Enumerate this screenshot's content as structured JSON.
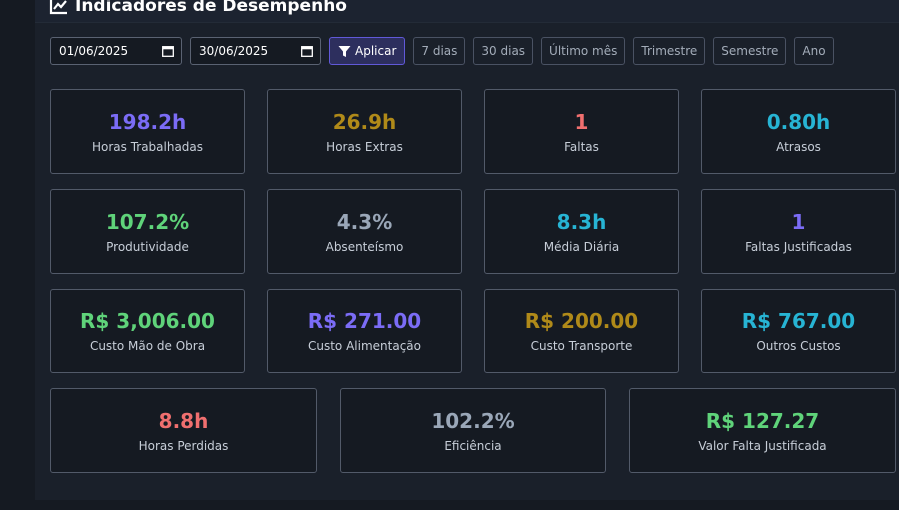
{
  "header": {
    "title": "Indicadores de Desempenho",
    "icon": "chart-line-icon"
  },
  "filters": {
    "start_date": "01/06/2025",
    "end_date": "30/06/2025",
    "apply_label": "Aplicar",
    "presets": [
      "7 dias",
      "30 dias",
      "Último mês",
      "Trimestre",
      "Semestre",
      "Ano"
    ]
  },
  "colors": {
    "purple": "#7b6cf6",
    "gold": "#b08a19",
    "red": "#f06f6f",
    "cyan": "#27b4d4",
    "green": "#5fd37a",
    "slate": "#9aa7b8"
  },
  "metrics": [
    {
      "value": "198.2h",
      "label": "Horas Trabalhadas",
      "color": "#7b6cf6"
    },
    {
      "value": "26.9h",
      "label": "Horas Extras",
      "color": "#b08a19"
    },
    {
      "value": "1",
      "label": "Faltas",
      "color": "#f06f6f"
    },
    {
      "value": "0.80h",
      "label": "Atrasos",
      "color": "#27b4d4"
    },
    {
      "value": "107.2%",
      "label": "Produtividade",
      "color": "#5fd37a"
    },
    {
      "value": "4.3%",
      "label": "Absenteísmo",
      "color": "#9aa7b8"
    },
    {
      "value": "8.3h",
      "label": "Média Diária",
      "color": "#27b4d4"
    },
    {
      "value": "1",
      "label": "Faltas Justificadas",
      "color": "#7b6cf6"
    },
    {
      "value": "R$ 3,006.00",
      "label": "Custo Mão de Obra",
      "color": "#5fd37a"
    },
    {
      "value": "R$ 271.00",
      "label": "Custo Alimentação",
      "color": "#7b6cf6"
    },
    {
      "value": "R$ 200.00",
      "label": "Custo Transporte",
      "color": "#b08a19"
    },
    {
      "value": "R$ 767.00",
      "label": "Outros Custos",
      "color": "#27b4d4"
    },
    {
      "value": "8.8h",
      "label": "Horas Perdidas",
      "color": "#f06f6f"
    },
    {
      "value": "102.2%",
      "label": "Eficiência",
      "color": "#9aa7b8"
    },
    {
      "value": "R$ 127.27",
      "label": "Valor Falta Justificada",
      "color": "#5fd37a"
    }
  ]
}
